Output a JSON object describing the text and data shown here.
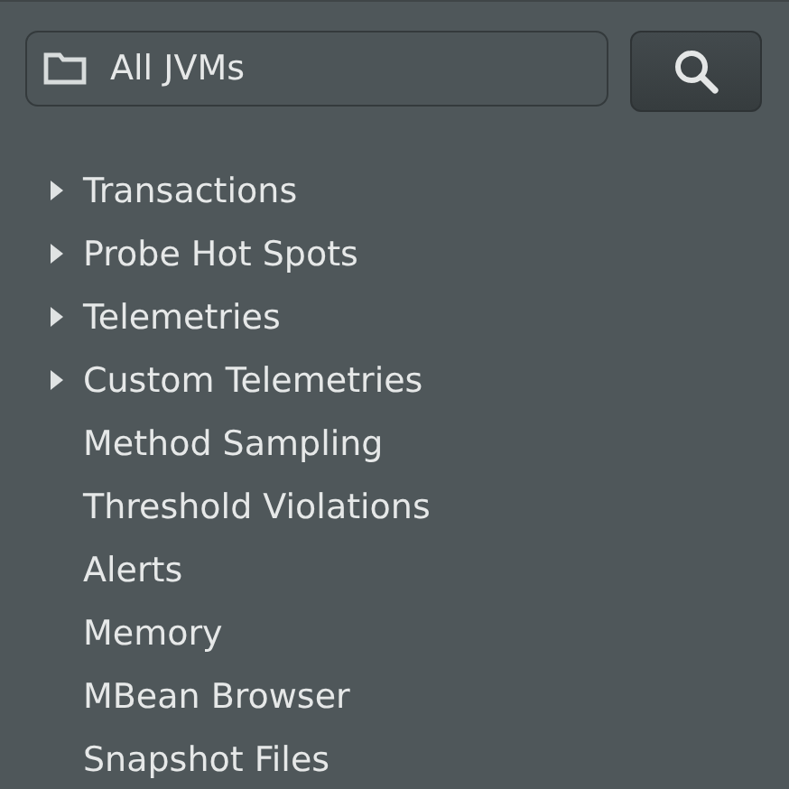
{
  "selector": {
    "value": "All JVMs"
  },
  "tree": [
    {
      "label": "Transactions",
      "kind": "node",
      "expanded": false
    },
    {
      "label": "Probe Hot Spots",
      "kind": "node",
      "expanded": false
    },
    {
      "label": "Telemetries",
      "kind": "node",
      "expanded": false
    },
    {
      "label": "Custom Telemetries",
      "kind": "node",
      "expanded": false
    },
    {
      "label": "Method Sampling",
      "kind": "leaf"
    },
    {
      "label": "Threshold Violations",
      "kind": "leaf"
    },
    {
      "label": "Alerts",
      "kind": "leaf"
    },
    {
      "label": "Memory",
      "kind": "leaf"
    },
    {
      "label": "MBean Browser",
      "kind": "leaf"
    },
    {
      "label": "Snapshot Files",
      "kind": "leaf"
    }
  ]
}
